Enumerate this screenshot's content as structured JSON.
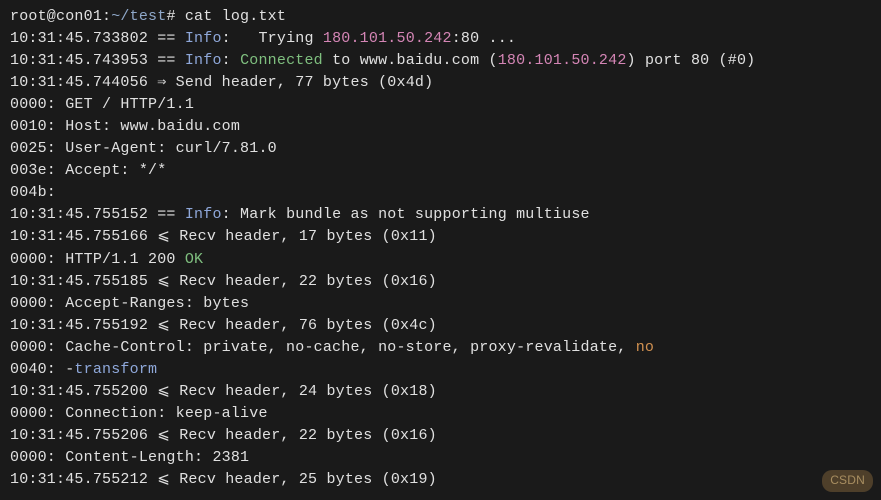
{
  "prompt": {
    "user": "root@con01",
    "path": "~/test",
    "symbol": "#",
    "command": "cat log.txt"
  },
  "lines": [
    {
      "ts": "10:31:45.733802",
      "sep": "==",
      "type": "info",
      "text1": "   Trying ",
      "ip": "180.101.50.242",
      "text2": ":80 ..."
    },
    {
      "ts": "10:31:45.743953",
      "sep": "==",
      "type": "info",
      "connected": "Connected",
      "text1": " to www.baidu.com (",
      "ip": "180.101.50.242",
      "text2": ") port 80 (#0)"
    },
    {
      "ts": "10:31:45.744056",
      "sep": "⇒",
      "text": "Send header, 77 bytes (0x4d)"
    },
    {
      "offset": "0000:",
      "text": "GET / HTTP/1.1"
    },
    {
      "offset": "0010:",
      "text": "Host: www.baidu.com"
    },
    {
      "offset": "0025:",
      "text": "User-Agent: curl/7.81.0"
    },
    {
      "offset": "003e:",
      "text": "Accept: */*"
    },
    {
      "offset": "004b:",
      "text": ""
    },
    {
      "ts": "10:31:45.755152",
      "sep": "==",
      "type": "info",
      "text1": " Mark bundle as not supporting multiuse"
    },
    {
      "ts": "10:31:45.755166",
      "sep": "⩽",
      "text": "Recv header, 17 bytes (0x11)"
    },
    {
      "offset": "0000:",
      "text": "HTTP/1.1 200 ",
      "ok": "OK"
    },
    {
      "ts": "10:31:45.755185",
      "sep": "⩽",
      "text": "Recv header, 22 bytes (0x16)"
    },
    {
      "offset": "0000:",
      "text": "Accept-Ranges: bytes"
    },
    {
      "ts": "10:31:45.755192",
      "sep": "⩽",
      "text": "Recv header, 76 bytes (0x4c)"
    },
    {
      "offset": "0000:",
      "text": "Cache-Control: private, no-cache, no-store, proxy-revalidate, ",
      "no": "no"
    },
    {
      "offset": "0040:",
      "dash": "-",
      "transform": "transform"
    },
    {
      "ts": "10:31:45.755200",
      "sep": "⩽",
      "text": "Recv header, 24 bytes (0x18)"
    },
    {
      "offset": "0000:",
      "text": "Connection: keep-alive"
    },
    {
      "ts": "10:31:45.755206",
      "sep": "⩽",
      "text": "Recv header, 22 bytes (0x16)"
    },
    {
      "offset": "0000:",
      "text": "Content-Length: 2381"
    },
    {
      "ts": "10:31:45.755212",
      "sep": "⩽",
      "text": "Recv header, 25 bytes (0x19)"
    }
  ],
  "watermark": "CSDN"
}
